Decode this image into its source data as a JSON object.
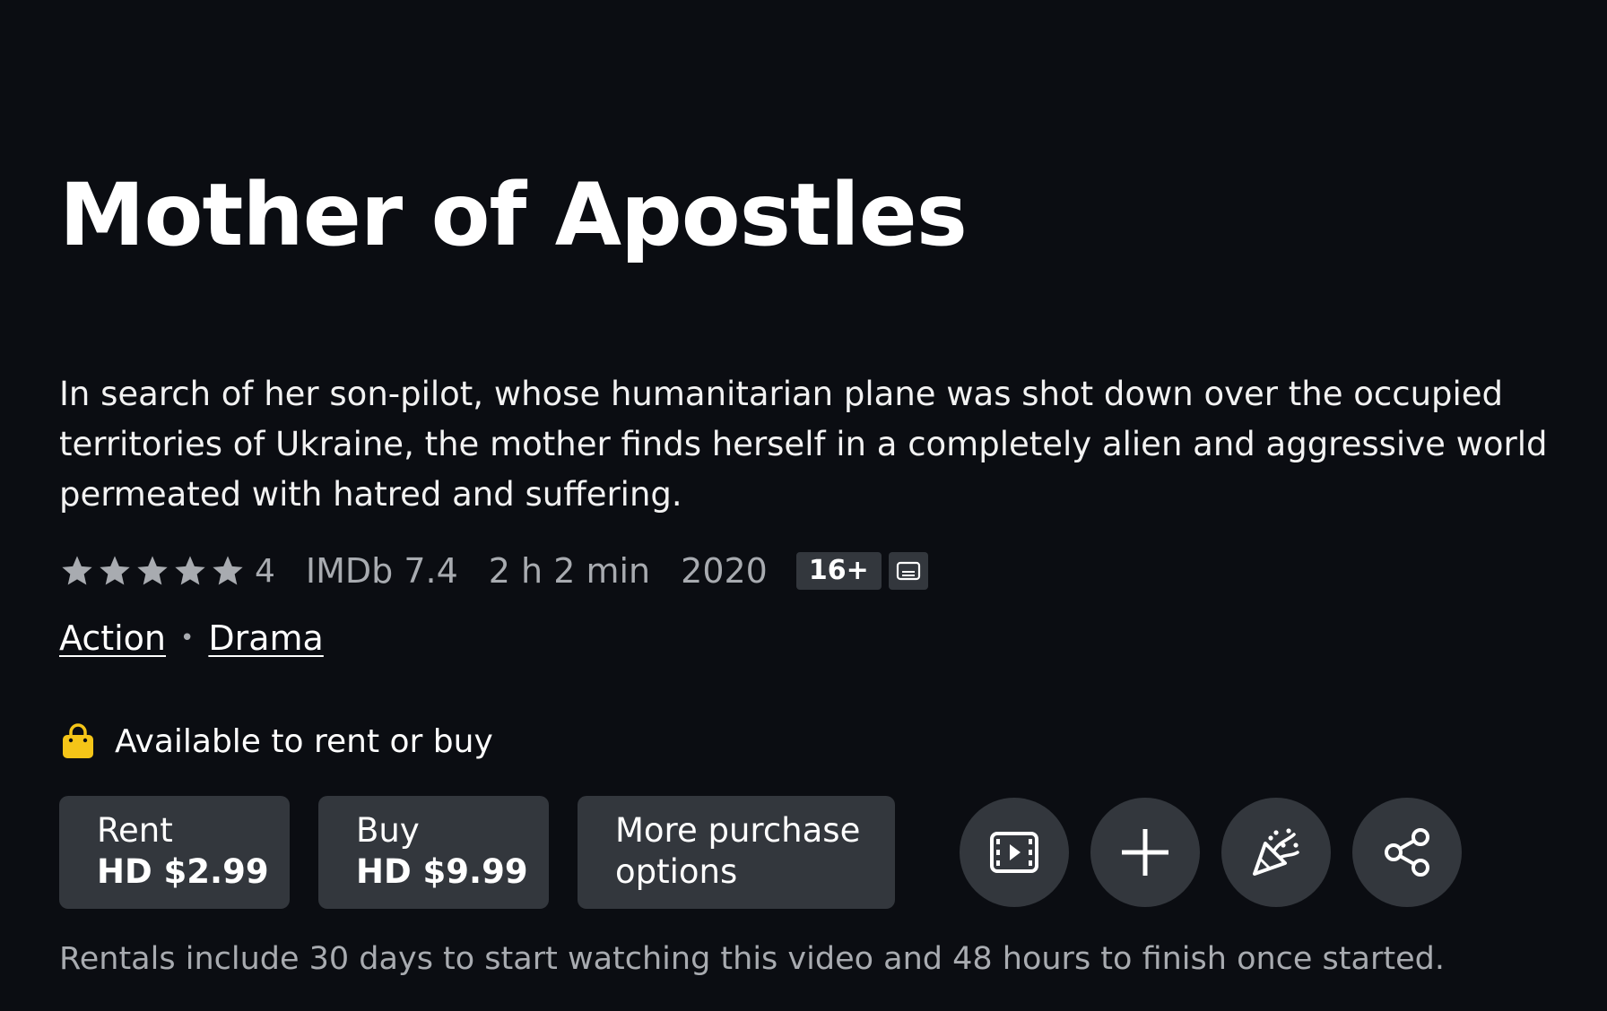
{
  "title": "Mother of Apostles",
  "synopsis": "In search of her son-pilot, whose humanitarian plane was shot down over the occupied territories of Ukraine, the mother finds herself in a completely alien and aggressive world permeated with hatred and suffering.",
  "meta": {
    "star_rating": 5,
    "rating_count": "4",
    "imdb": "IMDb 7.4",
    "runtime": "2 h 2 min",
    "year": "2020",
    "maturity_rating": "16+",
    "subtitles_icon": "subtitles-icon"
  },
  "genres": [
    "Action",
    "Drama"
  ],
  "genre_separator": "•",
  "availability": {
    "icon": "shopping-bag-icon",
    "text": "Available to rent or buy"
  },
  "purchase": {
    "rent": {
      "line1": "Rent",
      "line2": "HD $2.99"
    },
    "buy": {
      "line1": "Buy",
      "line2": "HD $9.99"
    },
    "more": {
      "line1": "More purchase",
      "line2": "options"
    }
  },
  "action_icons": [
    "trailer-icon",
    "plus-icon",
    "party-icon",
    "share-icon"
  ],
  "footnote": "Rentals include 30 days to start watching this video and 48 hours to finish once started.",
  "colors": {
    "background": "#0b0d12",
    "button": "#33373d",
    "muted_text": "#a8abb0",
    "bag_yellow": "#f5c518"
  }
}
